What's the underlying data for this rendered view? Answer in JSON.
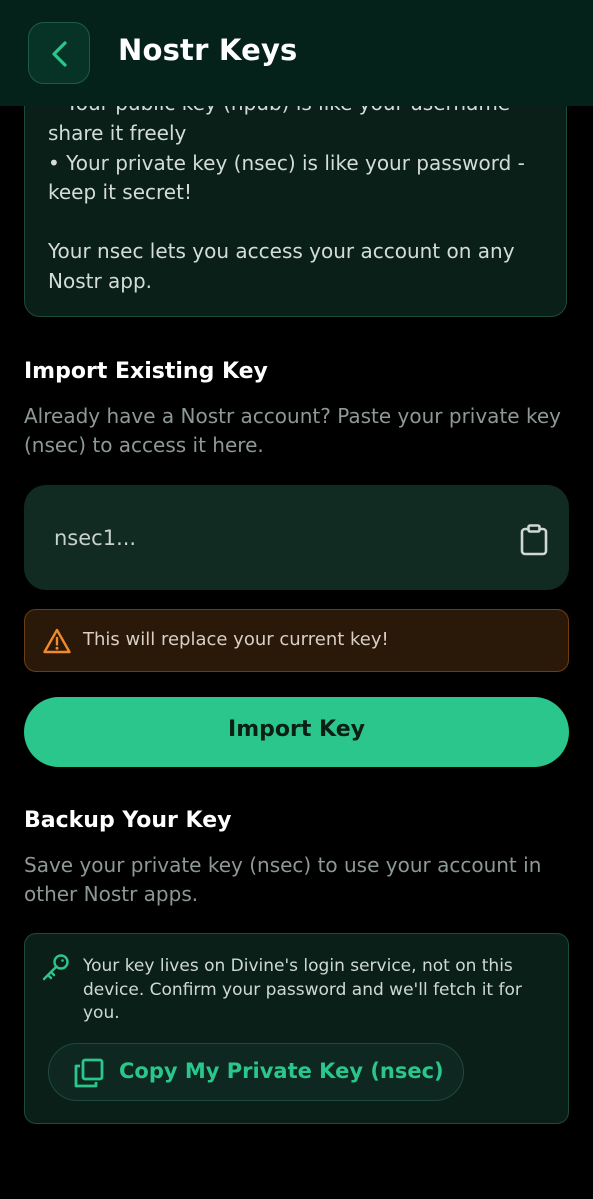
{
  "header": {
    "title": "Nostr Keys",
    "back_icon": "chevron-left-icon"
  },
  "info": {
    "lines": [
      "• Your public key (npub) is like your username -",
      "share it freely",
      "• Your private key (nsec) is like your password -",
      "keep it secret!",
      "Your nsec lets you access your account on any",
      "Nostr app."
    ]
  },
  "import": {
    "title": "Import Existing Key",
    "description_lines": [
      "Already have a Nostr account? Paste your private key",
      "(nsec) to access it here."
    ],
    "input_placeholder": "nsec1...",
    "input_value": "",
    "paste_icon": "clipboard-icon",
    "warning_icon": "warning-icon",
    "warning_text": "This will replace your current key!",
    "button_label": "Import Key"
  },
  "backup": {
    "title": "Backup Your Key",
    "description_lines": [
      "Save your private key (nsec) to use your account in",
      "other Nostr apps."
    ],
    "key_icon": "key-icon",
    "info_lines": [
      "Your key lives on Divine's login service, not on this",
      "device. Confirm your password and we'll fetch it for",
      "you."
    ],
    "copy_icon": "copy-icon",
    "copy_button_label": "Copy My Private Key (nsec)"
  },
  "colors": {
    "accent": "#2ac68c",
    "header_bg": "#04221a",
    "card_bg": "#0b1f19",
    "warning_bg": "#2a1808",
    "warning_icon": "#f08a2a"
  }
}
